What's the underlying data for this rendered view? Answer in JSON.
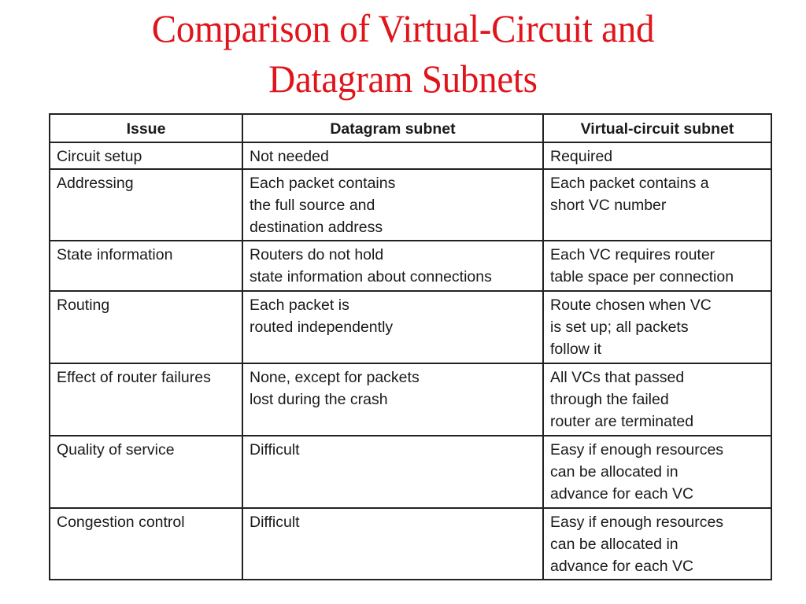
{
  "title": {
    "line1": "Comparison of Virtual-Circuit and",
    "line2": "Datagram Subnets",
    "color": "#e0141b"
  },
  "table": {
    "headers": [
      "Issue",
      "Datagram subnet",
      "Virtual-circuit subnet"
    ],
    "rows": [
      {
        "issue": [
          "Circuit setup"
        ],
        "datagram": [
          "Not needed"
        ],
        "virtual_circuit": [
          "Required"
        ]
      },
      {
        "issue": [
          "Addressing"
        ],
        "datagram": [
          "Each packet contains",
          "the full source and",
          "destination address"
        ],
        "virtual_circuit": [
          "Each packet contains a",
          "short VC number"
        ]
      },
      {
        "issue": [
          "State information"
        ],
        "datagram": [
          "Routers do not hold",
          "state information about connections"
        ],
        "virtual_circuit": [
          "Each VC requires router",
          "table space per connection"
        ]
      },
      {
        "issue": [
          "Routing"
        ],
        "datagram": [
          "Each packet is",
          "routed independently"
        ],
        "virtual_circuit": [
          "Route chosen when VC",
          "is set up; all packets",
          "follow it"
        ]
      },
      {
        "issue": [
          "Effect of router failures"
        ],
        "datagram": [
          "None, except for packets",
          "lost during the crash"
        ],
        "virtual_circuit": [
          "All VCs that passed",
          "through the failed",
          "router are terminated"
        ]
      },
      {
        "issue": [
          "Quality of service"
        ],
        "datagram": [
          "Difficult"
        ],
        "virtual_circuit": [
          "Easy if enough resources",
          "can be allocated in",
          "advance for each VC"
        ]
      },
      {
        "issue": [
          "Congestion control"
        ],
        "datagram": [
          "Difficult"
        ],
        "virtual_circuit": [
          "Easy if enough resources",
          "can be allocated in",
          "advance for each VC"
        ]
      }
    ]
  }
}
